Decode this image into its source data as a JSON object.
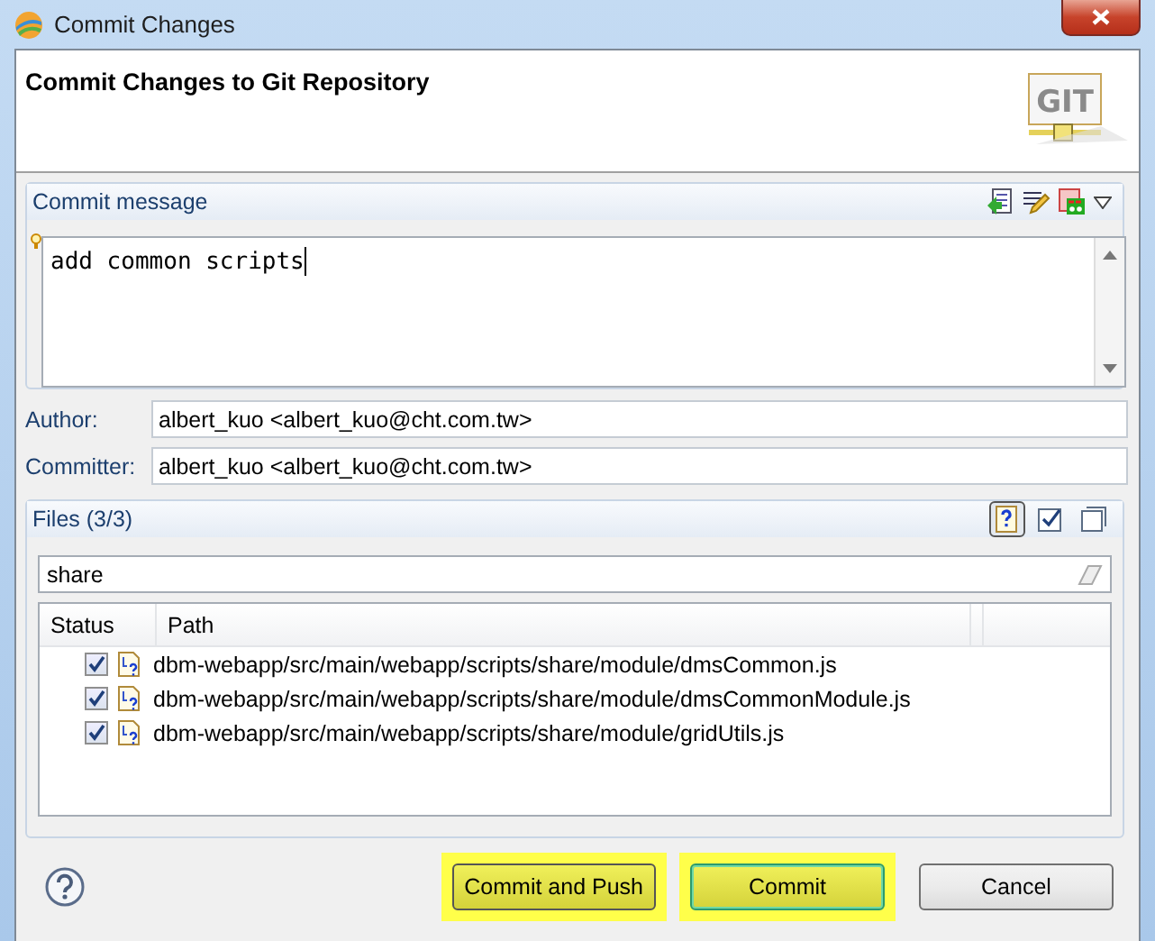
{
  "window": {
    "title": "Commit Changes"
  },
  "header": {
    "title": "Commit Changes to Git Repository",
    "logo_text": "GIT"
  },
  "commit_message": {
    "title": "Commit message",
    "value": "add common scripts"
  },
  "author": {
    "label": "Author:",
    "value": "albert_kuo <albert_kuo@cht.com.tw>"
  },
  "committer": {
    "label": "Committer:",
    "value": "albert_kuo <albert_kuo@cht.com.tw>"
  },
  "files": {
    "title": "Files (3/3)",
    "toolbar": [
      {
        "kind": "untracked",
        "selected": true
      },
      {
        "kind": "check-all",
        "selected": false
      },
      {
        "kind": "uncheck-all",
        "selected": false
      }
    ],
    "filter": {
      "value": "share"
    },
    "columns": [
      "Status",
      "Path"
    ],
    "rows": [
      {
        "checked": true,
        "path": "dbm-webapp/src/main/webapp/scripts/share/module/dmsCommon.js"
      },
      {
        "checked": true,
        "path": "dbm-webapp/src/main/webapp/scripts/share/module/dmsCommonModule.js"
      },
      {
        "checked": true,
        "path": "dbm-webapp/src/main/webapp/scripts/share/module/gridUtils.js"
      }
    ]
  },
  "buttons": [
    {
      "label": "Commit and Push",
      "kind": "normal",
      "highlighted": true
    },
    {
      "label": "Commit",
      "kind": "default",
      "highlighted": true
    },
    {
      "label": "Cancel",
      "kind": "normal",
      "highlighted": false
    }
  ]
}
